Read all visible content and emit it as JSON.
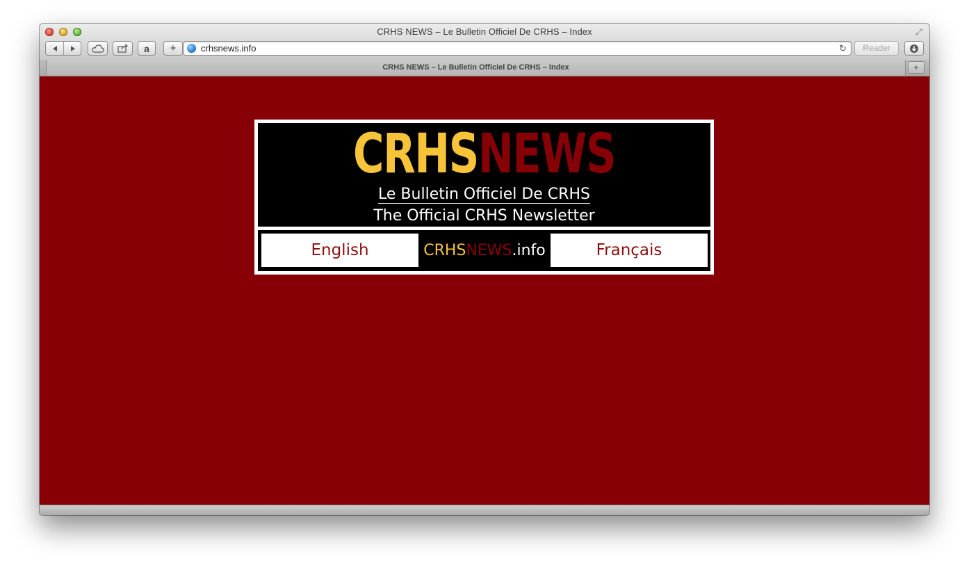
{
  "window": {
    "title": "CRHS NEWS – Le Bulletin Officiel De CRHS – Index"
  },
  "toolbar": {
    "back_icon": "back-arrow-icon",
    "forward_icon": "forward-arrow-icon",
    "icloud_icon": "cloud-icon",
    "share_icon": "share-icon",
    "amazon_icon": "amazon-icon",
    "add_icon": "plus-icon",
    "url": "crhsnews.info",
    "reader_label": "Reader",
    "downloads_icon": "download-icon"
  },
  "tabs": [
    {
      "label": "CRHS NEWS – Le Bulletin Officiel De CRHS – Index"
    }
  ],
  "site": {
    "logo_part1": "CRHS",
    "logo_part2": "NEWS",
    "subtitle_fr": "Le Bulletin Officiel De CRHS",
    "subtitle_en": "The Official CRHS Newsletter",
    "nav": {
      "english": "English",
      "francais": "Français",
      "center_part1": "CRHS",
      "center_part2": "NEWS",
      "center_part3": ".info"
    },
    "colors": {
      "background": "#870006",
      "logo_yellow": "#f6c339",
      "logo_red": "#870006",
      "link_red": "#8a0e10"
    }
  }
}
